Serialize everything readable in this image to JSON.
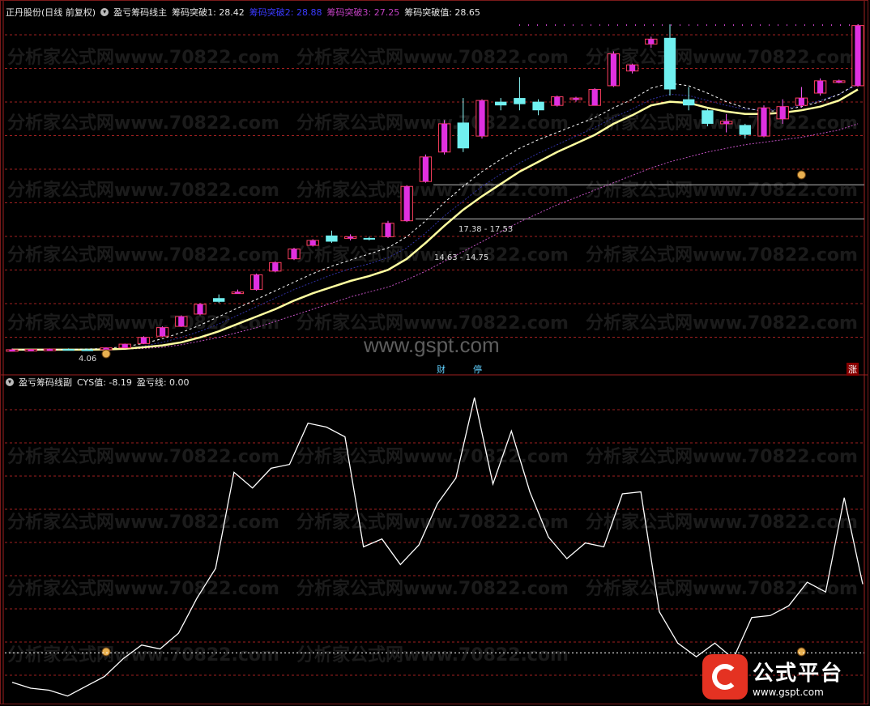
{
  "main_header": {
    "stock": "正丹股份(日线 前复权)",
    "indicator": "盈亏筹码线主",
    "b1": "筹码突破1: 28.42",
    "b2": "筹码突破2: 28.88",
    "b3": "筹码突破3: 27.25",
    "bv": "筹码突破值: 28.65"
  },
  "sub_header": {
    "indicator": "盈亏筹码线副",
    "cys": "CYS值: -8.19",
    "pl": "盈亏线: 0.00"
  },
  "labels": {
    "range1": "17.38 - 17.53",
    "range2": "14.63 - 14.75",
    "low": "4.06",
    "cai": "财",
    "ting": "停",
    "zhang": "涨"
  },
  "watermark": "分析家公式网www.70822.com",
  "site": "www.gspt.com",
  "logo": {
    "big": "公式平台",
    "small": "www.gspt.com"
  },
  "colors": {
    "up": "#e030e0",
    "down": "#70f0f0",
    "ma1": "#ffffa0",
    "ma2": "#c050c0",
    "grid": "#a02020",
    "osc": "#ffffff"
  },
  "chart_data": [
    {
      "type": "candlestick",
      "title": "盈亏筹码线主",
      "candles": [
        [
          4.1,
          4.2,
          4.0,
          4.1
        ],
        [
          4.1,
          4.15,
          4.05,
          4.12
        ],
        [
          4.12,
          4.2,
          4.08,
          4.15
        ],
        [
          4.15,
          4.2,
          4.1,
          4.12
        ],
        [
          4.12,
          4.18,
          4.06,
          4.1
        ],
        [
          4.1,
          4.3,
          4.06,
          4.25
        ],
        [
          4.25,
          4.6,
          4.2,
          4.55
        ],
        [
          4.6,
          5.2,
          4.55,
          5.1
        ],
        [
          5.2,
          6.0,
          5.15,
          5.9
        ],
        [
          6.0,
          6.9,
          5.95,
          6.8
        ],
        [
          7.0,
          7.9,
          6.9,
          7.8
        ],
        [
          8.3,
          8.6,
          7.9,
          8.0
        ],
        [
          8.8,
          9.0,
          8.7,
          8.8
        ],
        [
          9.0,
          10.3,
          8.9,
          10.2
        ],
        [
          10.5,
          11.3,
          10.4,
          11.2
        ],
        [
          11.5,
          12.4,
          11.4,
          12.3
        ],
        [
          12.6,
          13.1,
          12.5,
          13.0
        ],
        [
          13.4,
          13.8,
          12.8,
          12.9
        ],
        [
          13.2,
          13.5,
          13.0,
          13.3
        ],
        [
          13.2,
          13.3,
          13.0,
          13.1
        ],
        [
          13.3,
          14.6,
          13.2,
          14.4
        ],
        [
          14.6,
          17.5,
          14.5,
          17.4
        ],
        [
          17.8,
          20.0,
          17.7,
          19.8
        ],
        [
          20.2,
          22.8,
          20.0,
          22.5
        ],
        [
          22.6,
          24.6,
          20.2,
          20.5
        ],
        [
          21.5,
          24.5,
          21.3,
          24.4
        ],
        [
          24.3,
          24.6,
          23.6,
          24.0
        ],
        [
          24.6,
          26.3,
          23.6,
          24.1
        ],
        [
          24.3,
          24.5,
          23.2,
          23.6
        ],
        [
          24.0,
          24.8,
          23.9,
          24.7
        ],
        [
          24.5,
          24.7,
          24.3,
          24.6
        ],
        [
          24.0,
          25.4,
          24.0,
          25.3
        ],
        [
          25.6,
          28.4,
          25.5,
          28.2
        ],
        [
          26.8,
          27.4,
          26.6,
          27.3
        ],
        [
          29.0,
          29.6,
          28.7,
          29.4
        ],
        [
          29.5,
          30.6,
          24.8,
          25.3
        ],
        [
          24.5,
          25.5,
          23.6,
          24.0
        ],
        [
          23.6,
          23.7,
          22.3,
          22.5
        ],
        [
          22.5,
          23.3,
          21.8,
          22.7
        ],
        [
          22.4,
          22.5,
          21.3,
          21.6
        ],
        [
          21.5,
          24.0,
          21.4,
          23.8
        ],
        [
          22.9,
          24.5,
          22.5,
          23.9
        ],
        [
          24.0,
          25.5,
          23.8,
          24.6
        ],
        [
          25.0,
          26.2,
          24.8,
          26.0
        ],
        [
          26.0,
          26.1,
          25.8,
          26.0
        ],
        [
          25.6,
          30.6,
          25.5,
          30.5
        ]
      ],
      "ma1": [
        4.1,
        4.1,
        4.1,
        4.1,
        4.1,
        4.12,
        4.18,
        4.3,
        4.45,
        4.7,
        5.1,
        5.6,
        6.2,
        6.8,
        7.4,
        8.1,
        8.7,
        9.2,
        9.7,
        10.1,
        10.6,
        11.5,
        12.8,
        14.2,
        15.5,
        16.6,
        17.6,
        18.6,
        19.4,
        20.2,
        20.9,
        21.6,
        22.5,
        23.2,
        24.0,
        24.3,
        24.2,
        23.8,
        23.5,
        23.3,
        23.3,
        23.4,
        23.6,
        23.9,
        24.4,
        25.3
      ],
      "ma2": [
        4.1,
        4.1,
        4.1,
        4.1,
        4.1,
        4.1,
        4.15,
        4.2,
        4.3,
        4.5,
        4.8,
        5.1,
        5.5,
        5.9,
        6.4,
        6.9,
        7.4,
        7.9,
        8.4,
        8.8,
        9.2,
        9.8,
        10.5,
        11.3,
        12.1,
        12.9,
        13.7,
        14.5,
        15.2,
        15.9,
        16.5,
        17.1,
        17.7,
        18.3,
        18.9,
        19.4,
        19.8,
        20.2,
        20.5,
        20.8,
        21.0,
        21.2,
        21.4,
        21.7,
        22.0,
        22.5
      ],
      "ma3": [
        4.1,
        4.1,
        4.1,
        4.12,
        4.15,
        4.2,
        4.35,
        4.6,
        5.0,
        5.5,
        6.1,
        6.8,
        7.5,
        8.2,
        8.9,
        9.6,
        10.3,
        10.9,
        11.4,
        11.9,
        12.4,
        13.3,
        14.6,
        16.1,
        17.4,
        18.6,
        19.6,
        20.5,
        21.2,
        21.8,
        22.4,
        23.0,
        23.8,
        24.5,
        25.4,
        25.8,
        25.6,
        25.0,
        24.3,
        23.8,
        23.5,
        23.6,
        23.9,
        24.3,
        24.9,
        25.8
      ],
      "ma4": [
        4.1,
        4.1,
        4.1,
        4.1,
        4.1,
        4.12,
        4.2,
        4.4,
        4.7,
        5.1,
        5.6,
        6.2,
        6.9,
        7.6,
        8.3,
        9.0,
        9.6,
        10.2,
        10.7,
        11.1,
        11.6,
        12.4,
        13.6,
        15.0,
        16.2,
        17.4,
        18.4,
        19.3,
        20.1,
        20.8,
        21.5,
        22.2,
        23.0,
        23.7,
        24.5,
        24.9,
        24.8,
        24.4,
        24.0,
        23.7,
        23.6,
        23.7,
        24.0,
        24.4,
        24.9,
        25.7
      ],
      "ylim": [
        3.5,
        31.2
      ]
    },
    {
      "type": "line",
      "title": "盈亏筹码线副",
      "values": [
        -15,
        -18,
        -19,
        -22,
        -17,
        -12,
        -3,
        4,
        2,
        10,
        28,
        43,
        92,
        84,
        94,
        96,
        117,
        115,
        110,
        54,
        58,
        45,
        55,
        76,
        89,
        130,
        86,
        113,
        82,
        59,
        48,
        56,
        54,
        81,
        82,
        21,
        5,
        -2,
        5,
        -3,
        18,
        19,
        24,
        36,
        31,
        79,
        35
      ],
      "ylim": [
        -25,
        135
      ]
    }
  ]
}
